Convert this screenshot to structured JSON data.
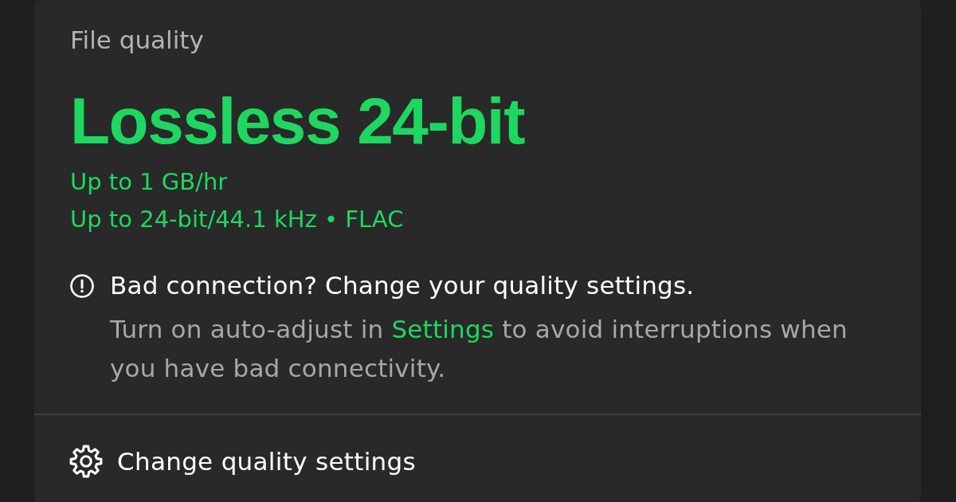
{
  "header": {
    "label": "File quality"
  },
  "quality": {
    "name": "Lossless 24-bit",
    "details": [
      "Up to 1 GB/hr",
      "Up to 24-bit/44.1 kHz • FLAC"
    ]
  },
  "notice": {
    "title": "Bad connection? Change your quality settings.",
    "text_before": "Turn on auto-adjust in ",
    "link": "Settings",
    "text_after": " to avoid interruptions when you have bad connectivity."
  },
  "action": {
    "label": "Change quality settings"
  }
}
